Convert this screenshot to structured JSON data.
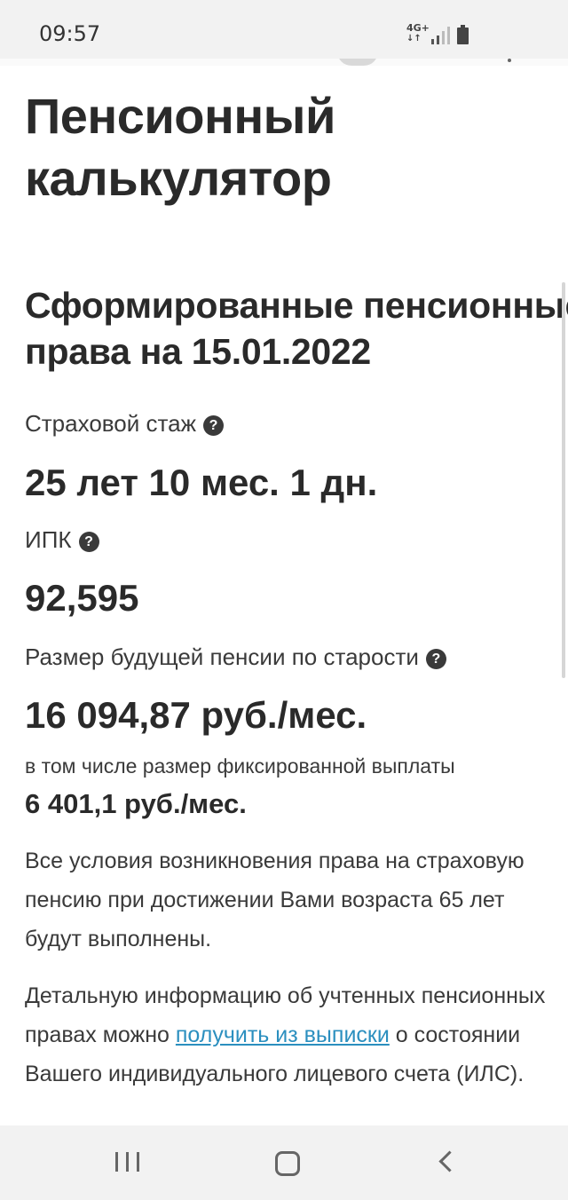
{
  "status_bar": {
    "time": "09:57",
    "network_label": "4G+",
    "icons": [
      "signal-icon",
      "battery-icon"
    ]
  },
  "page": {
    "title": "Пенсионный калькулятор",
    "section_title_line1": "Сформированные пенсионные",
    "section_title_line2": "права на 15.01.2022",
    "insurance_experience": {
      "label": "Страховой стаж",
      "value": "25 лет 10 мес. 1 дн."
    },
    "ipk": {
      "label": "ИПК",
      "value": "92,595"
    },
    "future_pension": {
      "label": "Размер будущей пенсии по старости",
      "value": "16 094,87 руб./мес.",
      "fixed_label": "в том числе размер фиксированной выплаты",
      "fixed_value": "6 401,1 руб./мес."
    },
    "conditions_text": "Все условия возникновения права на страховую пенсию при достижении Вами возраста 65 лет будут выполнены.",
    "details": {
      "before": "Детальную информацию об учтенных пенсионных правах можно ",
      "link": "получить из выписки",
      "after": " о состоянии Вашего индивидуального лицевого счета (ИЛС)."
    },
    "help_icon": "?"
  },
  "colors": {
    "text": "#2a2a2a",
    "link": "#2b8fbf",
    "bars": "#f2f2f2"
  },
  "nav_bar": {
    "buttons": [
      "recents-icon",
      "home-icon",
      "back-icon"
    ]
  }
}
